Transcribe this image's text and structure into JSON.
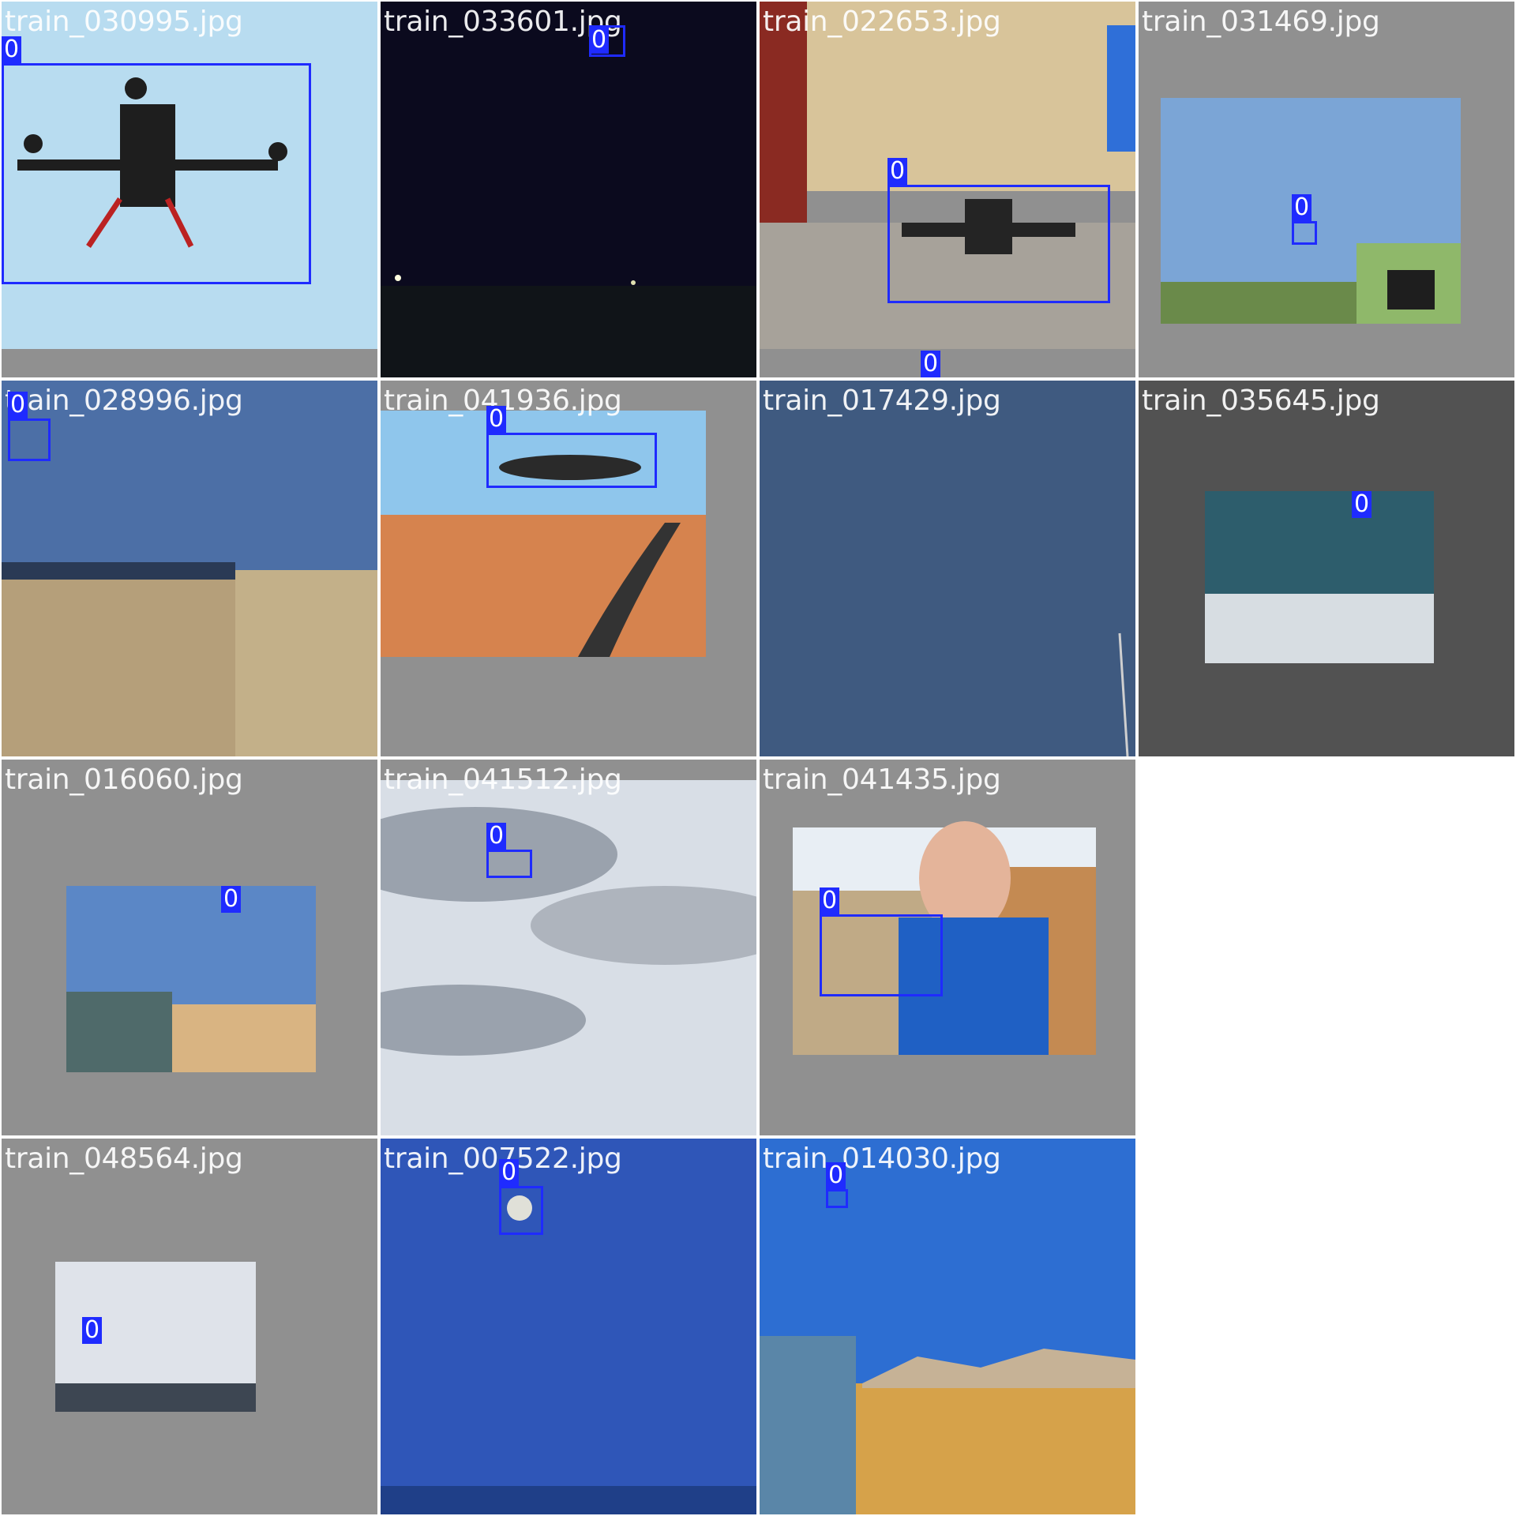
{
  "grid": {
    "tiles": [
      {
        "filename": "train_030995.jpg",
        "labels": [
          "0"
        ]
      },
      {
        "filename": "train_033601.jpg",
        "labels": [
          "0"
        ]
      },
      {
        "filename": "train_022653.jpg",
        "labels": [
          "0",
          "0"
        ]
      },
      {
        "filename": "train_031469.jpg",
        "labels": [
          "0"
        ]
      },
      {
        "filename": "train_028996.jpg",
        "labels": [
          "0"
        ]
      },
      {
        "filename": "train_041936.jpg",
        "labels": [
          "0"
        ]
      },
      {
        "filename": "train_017429.jpg",
        "labels": []
      },
      {
        "filename": "train_035645.jpg",
        "labels": [
          "0"
        ]
      },
      {
        "filename": "train_016060.jpg",
        "labels": [
          "0"
        ]
      },
      {
        "filename": "train_041512.jpg",
        "labels": [
          "0"
        ]
      },
      {
        "filename": "train_041435.jpg",
        "labels": [
          "0"
        ]
      },
      {
        "filename": "train_048564.jpg",
        "labels": [
          "0"
        ]
      },
      {
        "filename": "train_007522.jpg",
        "labels": [
          "0"
        ]
      },
      {
        "filename": "train_014030.jpg",
        "labels": [
          "0"
        ]
      }
    ],
    "box_color": "#1f2bff",
    "label_text_color": "#ffffff",
    "padding_color": "#909090"
  }
}
